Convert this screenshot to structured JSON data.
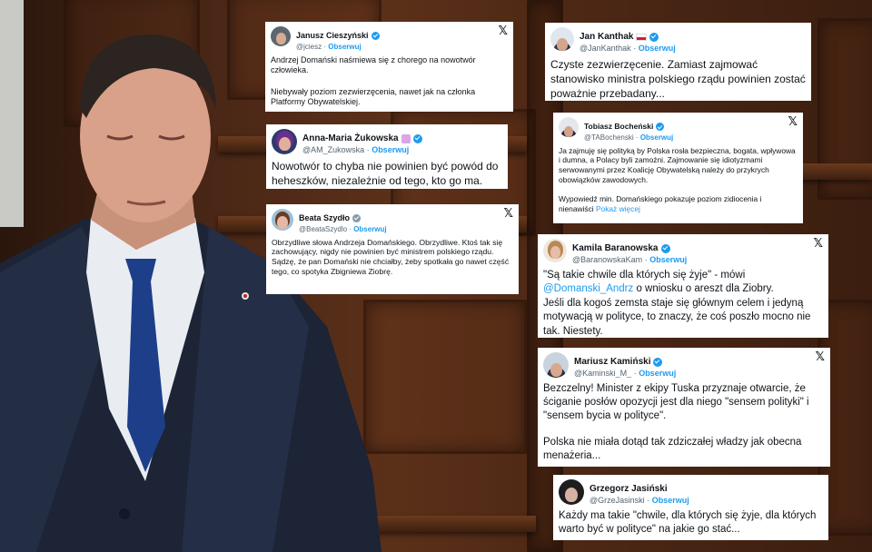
{
  "tweets": [
    {
      "name": "Janusz Cieszyński",
      "handle": "@jciesz",
      "follow": "Obserwuj",
      "text": "Andrzej Domański naśmiewa się z chorego na nowotwór człowieka.\n\nNiebywały poziom zezwierzęcenia, nawet jak na członka Platformy Obywatelskiej.",
      "verified": true,
      "x_logo": true
    },
    {
      "name": "Anna-Maria Żukowska",
      "handle": "@AM_Zukowska",
      "follow": "Obserwuj",
      "text": "Nowotwór to chyba nie powinien być powód do heheszków, niezależnie od tego, kto go ma.",
      "verified": true,
      "emoji": "woman-technologist-emoji"
    },
    {
      "name": "Beata Szydło",
      "handle": "@BeataSzydlo",
      "follow": "Obserwuj",
      "text": "Obrzydliwe słowa Andrzeja Domańskiego. Obrzydliwe. Ktoś tak się zachowujący, nigdy nie powinien być ministrem polskiego rządu. Sądzę, że pan Domański nie chciałby, żeby spotkała go nawet część tego, co spotyka Zbigniewa Ziobrę.",
      "verified": true,
      "x_logo": true
    },
    {
      "name": "Jan Kanthak",
      "handle": "@JanKanthak",
      "follow": "Obserwuj",
      "text": "Czyste zezwierzęcenie. Zamiast zajmować stanowisko ministra polskiego rządu powinien zostać poważnie przebadany...",
      "verified": true,
      "flag": "poland-flag"
    },
    {
      "name": "Tobiasz Bocheński",
      "handle": "@TABochenski",
      "follow": "Obserwuj",
      "text": "Ja zajmuję się polityką by Polska rosła bezpieczna, bogata, wpływowa i dumna, a Polacy byli zamożni. Zajmowanie się idiotyzmami serwowanymi przez Koalicję Obywatelską należy do przykrych obowiązków zawodowych.\n\nWypowiedź min. Domańskiego pokazuje poziom zidiocenia i nienawiści",
      "more": "Pokaż więcej",
      "verified": true,
      "x_logo": true
    },
    {
      "name": "Kamila Baranowska",
      "handle": "@BaranowskaKam",
      "follow": "Obserwuj",
      "text_before": "\"Są takie chwile dla których się żyje\" - mówi",
      "mention": "@Domanski_Andrz",
      "text_after": "o wniosku o areszt dla Ziobry.\nJeśli dla kogoś zemsta staje się głównym celem i jedyną motywacją w polityce, to znaczy, że coś poszło mocno nie tak. Niestety.",
      "verified": true,
      "x_logo": true
    },
    {
      "name": "Mariusz Kamiński",
      "handle": "@Kaminski_M_",
      "follow": "Obserwuj",
      "text": "Bezczelny! Minister z ekipy Tuska przyznaje otwarcie, że ściganie posłów opozycji jest dla niego \"sensem polityki\" i \"sensem bycia w polityce\".\n\nPolska nie miała dotąd tak zdziczałej władzy jak obecna menażeria...",
      "verified": true,
      "x_logo": true
    },
    {
      "name": "Grzegorz Jasiński",
      "handle": "@GrzeJasinski",
      "follow": "Obserwuj",
      "text": "Każdy ma takie \"chwile, dla których się żyje, dla których warto być w polityce\" na jakie go stać...",
      "verified": false
    }
  ],
  "separator": "·",
  "x_logo_glyph": "𝕏",
  "colors": {
    "link": "#1d9bf0",
    "text": "#0f1419",
    "muted": "#536471",
    "card": "#ffffff"
  }
}
